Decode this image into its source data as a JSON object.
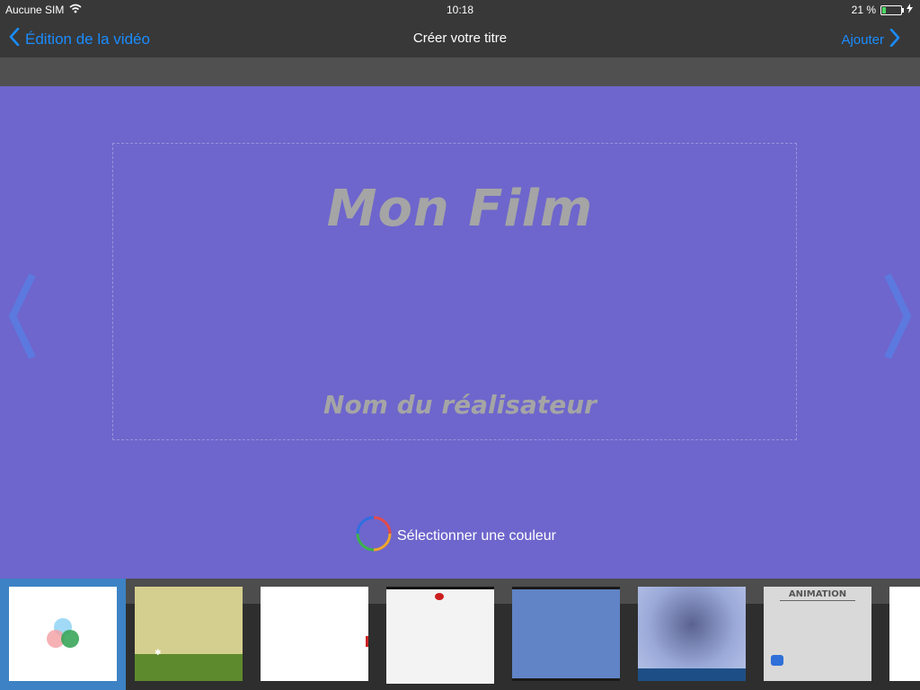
{
  "status": {
    "carrier": "Aucune SIM",
    "time": "10:18",
    "battery_percent": "21 %",
    "battery_level": 0.21,
    "wifi_icon": "wifi-icon"
  },
  "nav": {
    "back_label": "Édition de la vidéo",
    "title": "Créer votre titre",
    "add_label": "Ajouter"
  },
  "canvas": {
    "background_color": "#6e66cc",
    "film_title": "Mon Film",
    "director_placeholder": "Nom du réalisateur",
    "color_button_label": "Sélectionner une couleur"
  },
  "thumbnails": {
    "selected_index": 0,
    "items": [
      {
        "name": "custom-color-background"
      },
      {
        "name": "grass-field-background"
      },
      {
        "name": "white-background"
      },
      {
        "name": "ladybug-background"
      },
      {
        "name": "blue-frame-background"
      },
      {
        "name": "blue-vignette-background"
      },
      {
        "name": "animation-paper-background",
        "label": "ANIMATION"
      },
      {
        "name": "partial-background"
      }
    ]
  }
}
